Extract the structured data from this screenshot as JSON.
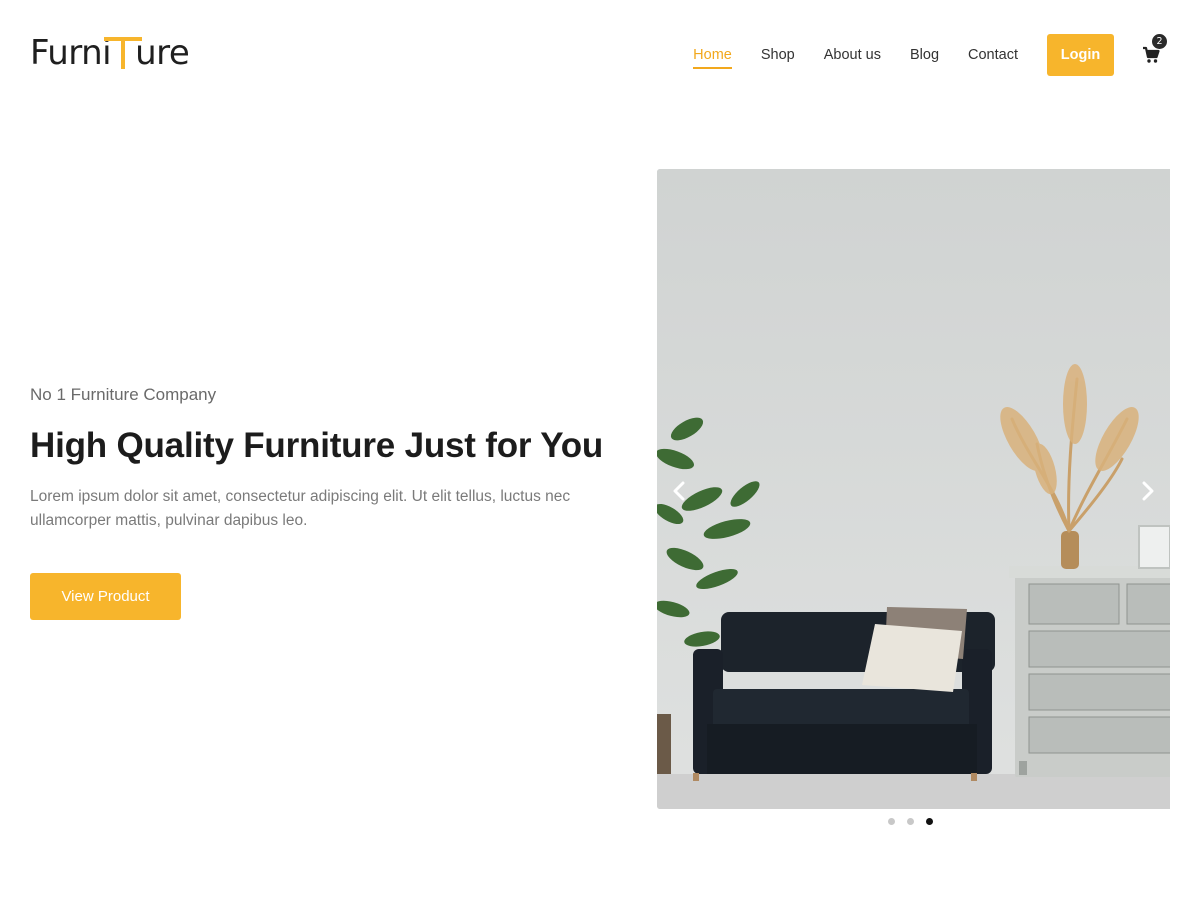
{
  "brand": {
    "logo_text_left": "Furni",
    "logo_text_right": "ure",
    "logo_letter": "T",
    "accent_color": "#f7b52c"
  },
  "nav": {
    "items": [
      {
        "label": "Home",
        "active": true
      },
      {
        "label": "Shop",
        "active": false
      },
      {
        "label": "About us",
        "active": false
      },
      {
        "label": "Blog",
        "active": false
      },
      {
        "label": "Contact",
        "active": false
      }
    ],
    "login_label": "Login",
    "cart_count": "2",
    "cart_icon": "shopping-cart-icon"
  },
  "hero": {
    "subtitle": "No 1 Furniture Company",
    "title": "High Quality Furniture Just for You",
    "description": "Lorem ipsum dolor sit amet, consectetur adipiscing elit. Ut elit tellus, luctus nec ullamcorper mattis, pulvinar dapibus leo.",
    "button_label": "View Product"
  },
  "carousel": {
    "prev_icon": "chevron-left-icon",
    "next_icon": "chevron-right-icon",
    "slide_count": 3,
    "active_slide": 3
  }
}
